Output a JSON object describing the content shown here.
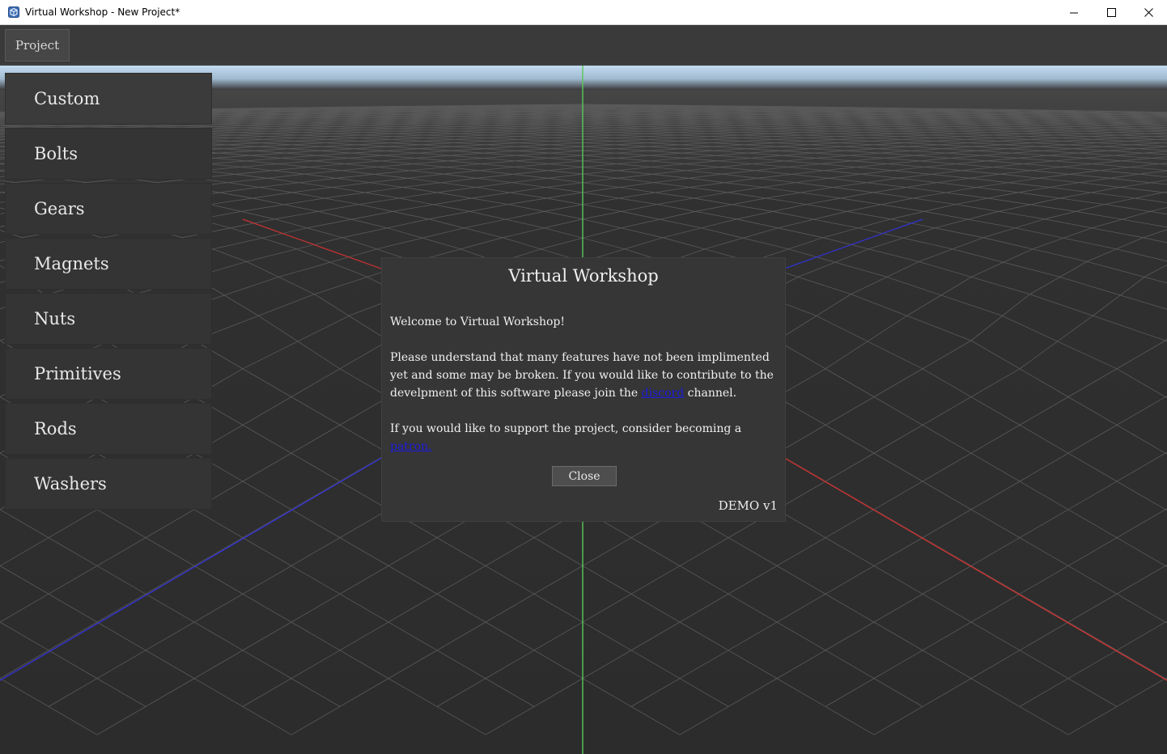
{
  "window": {
    "title": "Virtual Workshop - New Project*",
    "icon": "app-cube-icon"
  },
  "toolbar": {
    "project_label": "Project"
  },
  "sidebar": {
    "items": [
      {
        "label": "Custom",
        "active": true
      },
      {
        "label": "Bolts"
      },
      {
        "label": "Gears"
      },
      {
        "label": "Magnets"
      },
      {
        "label": "Nuts"
      },
      {
        "label": "Primitives"
      },
      {
        "label": "Rods"
      },
      {
        "label": "Washers"
      }
    ]
  },
  "dialog": {
    "title": "Virtual Workshop",
    "welcome": "Welcome to Virtual Workshop!",
    "para2_before": "Please understand that many features have not been implimented yet and some may be broken.  If you would like to contribute to the develpment of this software please join the ",
    "para2_link": "discord",
    "para2_after": " channel.",
    "para3_before": "If you would like to support the project, consider becoming a ",
    "para3_link": "patron.",
    "close_label": "Close",
    "version": "DEMO v1"
  },
  "colors": {
    "x_axis": "#c83232",
    "y_axis": "#5ac85a",
    "z_axis": "#3232d2",
    "grid": "#5a5a5a",
    "link": "#1a1adc"
  }
}
